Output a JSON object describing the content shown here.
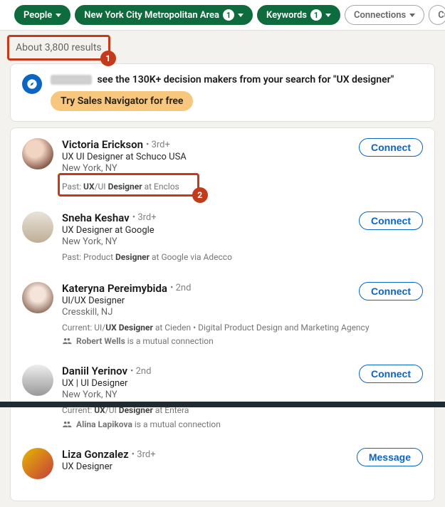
{
  "filters": {
    "people": "People",
    "location": "New York City Metropolitan Area",
    "location_count": "1",
    "keywords": "Keywords",
    "keywords_count": "1",
    "connections": "Connections",
    "current": "Current c"
  },
  "results_count": "About 3,800 results",
  "annotations": {
    "num1": "1",
    "num2": "2"
  },
  "salesnav": {
    "tail": " see the 130K+ decision makers from your search for \"UX designer\"",
    "cta": "Try Sales Navigator for free"
  },
  "results": [
    {
      "name": "Victoria Erickson",
      "degree": "• 3rd+",
      "headline": "UX UI Designer at Schuco USA",
      "location": "New York, NY",
      "meta_html": "Past: <b>UX</b>/UI <b>Designer</b> at Enclos",
      "action": "Connect"
    },
    {
      "name": "Sneha Keshav",
      "degree": "• 3rd+",
      "headline": "UX Designer at Google",
      "location": "New York, NY",
      "meta_html": "Past: Product <b>Designer</b> at Google via Adecco",
      "action": "Connect"
    },
    {
      "name": "Kateryna Pereimybida",
      "degree": "• 2nd",
      "headline": "UI/UX Designer",
      "location": "Cresskill, NJ",
      "meta_html": "Current: UI/<b>UX Designer</b> at Cieden • Digital Product Design and Marketing Agency",
      "mutual_html": "<b>Robert Wells</b> is a mutual connection",
      "action": "Connect"
    },
    {
      "name": "Daniil Yerinov",
      "degree": "• 2nd",
      "headline": "UX | UI Designer",
      "location": "New York, NY",
      "meta_html": "Current: <b>UX</b>/UI <b>Designer</b> at Entera",
      "mutual_html": "<b>Alina Lapikova</b> is a mutual connection",
      "action": "Connect"
    },
    {
      "name": "Liza Gonzalez",
      "degree": "• 3rd+",
      "headline": "UX Designer",
      "location": "",
      "action": "Message"
    }
  ]
}
